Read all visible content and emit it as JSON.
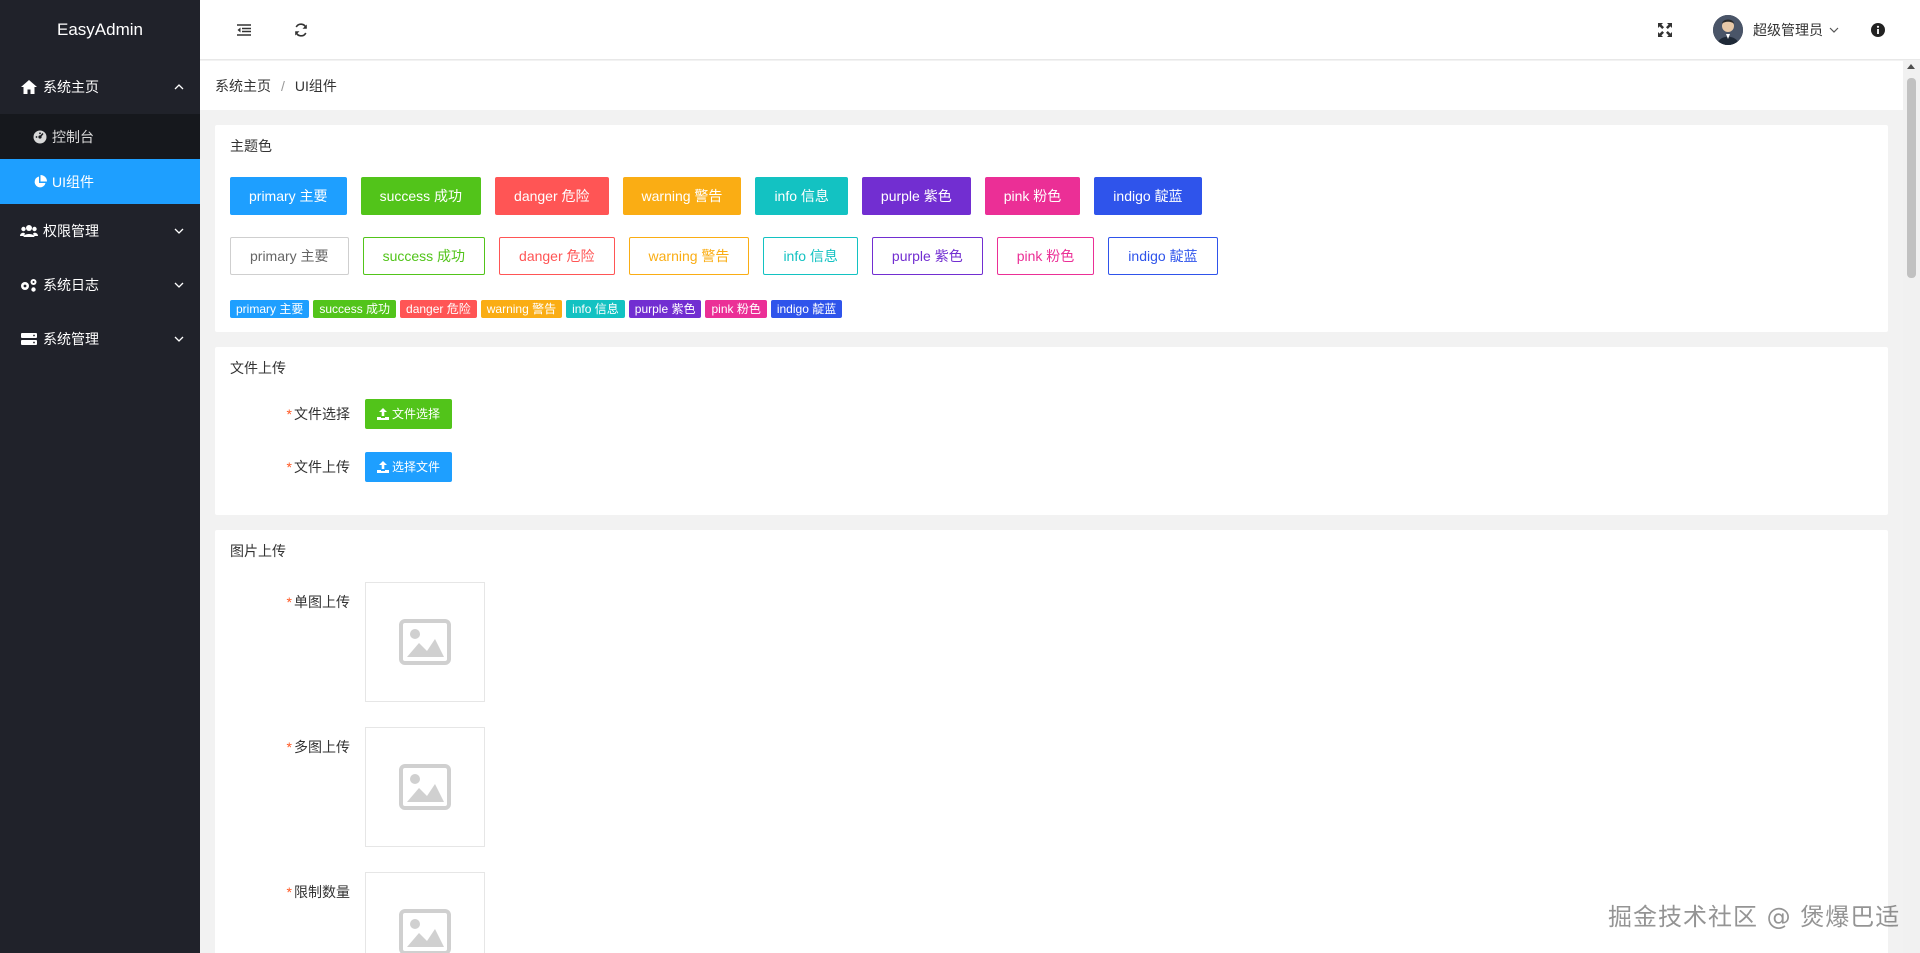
{
  "sidebar": {
    "logo": "EasyAdmin",
    "groups": [
      {
        "label": "系统主页",
        "expanded": true,
        "icon": "home-icon",
        "items": [
          {
            "label": "控制台",
            "icon": "dashboard-icon",
            "active": false
          },
          {
            "label": "UI组件",
            "icon": "pie-chart-icon",
            "active": true
          }
        ]
      },
      {
        "label": "权限管理",
        "icon": "users-icon"
      },
      {
        "label": "系统日志",
        "icon": "gears-icon"
      },
      {
        "label": "系统管理",
        "icon": "server-icon"
      }
    ]
  },
  "header": {
    "user_name": "超级管理员"
  },
  "breadcrumb": {
    "home": "系统主页",
    "separator": "/",
    "current": "UI组件"
  },
  "theme_card": {
    "title": "主题色",
    "buttons": [
      {
        "label": "primary 主要",
        "color": "#1e9fff"
      },
      {
        "label": "success 成功",
        "color": "#52c41a"
      },
      {
        "label": "danger 危险",
        "color": "#ff5555"
      },
      {
        "label": "warning 警告",
        "color": "#faad14"
      },
      {
        "label": "info 信息",
        "color": "#13c2c2"
      },
      {
        "label": "purple 紫色",
        "color": "#722ed1"
      },
      {
        "label": "pink 粉色",
        "color": "#eb2f96"
      },
      {
        "label": "indigo 靛蓝",
        "color": "#2f54eb"
      }
    ],
    "outline_buttons": [
      {
        "label": "primary 主要",
        "color": "#999999"
      },
      {
        "label": "success 成功",
        "color": "#52c41a"
      },
      {
        "label": "danger 危险",
        "color": "#ff5555"
      },
      {
        "label": "warning 警告",
        "color": "#faad14"
      },
      {
        "label": "info 信息",
        "color": "#13c2c2"
      },
      {
        "label": "purple 紫色",
        "color": "#722ed1"
      },
      {
        "label": "pink 粉色",
        "color": "#eb2f96"
      },
      {
        "label": "indigo 靛蓝",
        "color": "#2f54eb"
      }
    ],
    "badges": [
      {
        "label": "primary 主要",
        "color": "#1e9fff"
      },
      {
        "label": "success 成功",
        "color": "#52c41a"
      },
      {
        "label": "danger 危险",
        "color": "#ff5555"
      },
      {
        "label": "warning 警告",
        "color": "#faad14"
      },
      {
        "label": "info 信息",
        "color": "#13c2c2"
      },
      {
        "label": "purple 紫色",
        "color": "#722ed1"
      },
      {
        "label": "pink 粉色",
        "color": "#eb2f96"
      },
      {
        "label": "indigo 靛蓝",
        "color": "#2f54eb"
      }
    ]
  },
  "file_card": {
    "title": "文件上传",
    "rows": [
      {
        "label": "文件选择",
        "button": "文件选择",
        "color": "#52c41a"
      },
      {
        "label": "文件上传",
        "button": "选择文件",
        "color": "#1e9fff"
      }
    ]
  },
  "image_card": {
    "title": "图片上传",
    "rows": [
      {
        "label": "单图上传"
      },
      {
        "label": "多图上传"
      },
      {
        "label": "限制数量"
      }
    ]
  },
  "watermark": "掘金技术社区 @ 煲爆巴适"
}
